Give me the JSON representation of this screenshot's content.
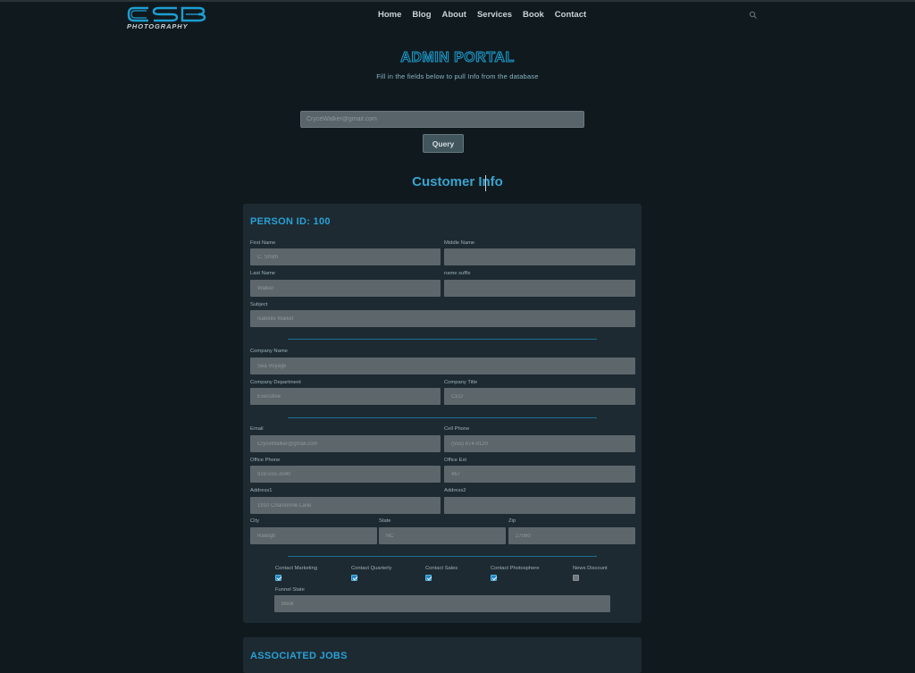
{
  "header": {
    "logo_text": "CSB",
    "logo_subtext": "PHOTOGRAPHY",
    "nav": [
      "Home",
      "Blog",
      "About",
      "Services",
      "Book",
      "Contact"
    ]
  },
  "portal": {
    "title": "ADMIN PORTAL",
    "subtitle": "Fill in the fields below to pull Info from the database",
    "query_value": "CryceWalker@gmail.com",
    "query_button": "Query",
    "section_title": "Customer Info"
  },
  "person": {
    "title": "PERSON ID: 100",
    "fields": {
      "first_name": {
        "label": "First Name",
        "value": "C. Smith"
      },
      "middle_name": {
        "label": "Middle Name",
        "value": ""
      },
      "last_name": {
        "label": "Last Name",
        "value": "Walker"
      },
      "name_suffix": {
        "label": "name suffix",
        "value": ""
      },
      "subject": {
        "label": "Subject",
        "value": "Isabelle Walker"
      },
      "company_name": {
        "label": "Company Name",
        "value": "Sea Voyage"
      },
      "company_department": {
        "label": "Company Department",
        "value": "Executive"
      },
      "company_title": {
        "label": "Company Title",
        "value": "CEO"
      },
      "email": {
        "label": "Email",
        "value": "CryceWalker@gmail.com"
      },
      "cell_phone": {
        "label": "Cell Phone",
        "value": "(555) 874-9120"
      },
      "office_phone": {
        "label": "Office Phone",
        "value": "919-555-3040"
      },
      "office_ext": {
        "label": "Office Ext",
        "value": "467"
      },
      "address1": {
        "label": "Address1",
        "value": "1910 Chamomile Lane"
      },
      "address2": {
        "label": "Address2",
        "value": ""
      },
      "city": {
        "label": "City",
        "value": "Raleigh"
      },
      "state": {
        "label": "State",
        "value": "NC"
      },
      "zip": {
        "label": "Zip",
        "value": "27560"
      },
      "funnel_state": {
        "label": "Funnel State",
        "value": "Book"
      }
    },
    "checkboxes": [
      {
        "label": "Contact Marketing",
        "checked": true
      },
      {
        "label": "Contact Quarterly",
        "checked": true
      },
      {
        "label": "Contact Sales",
        "checked": true
      },
      {
        "label": "Contact Photosphere",
        "checked": true
      },
      {
        "label": "News Discount",
        "checked": false
      }
    ]
  },
  "jobs": {
    "title": "ASSOCIATED JOBS"
  },
  "colors": {
    "background": "#101a1e",
    "card": "#1d2a31",
    "accent": "#2aa0d6",
    "field": "#5d666b"
  }
}
